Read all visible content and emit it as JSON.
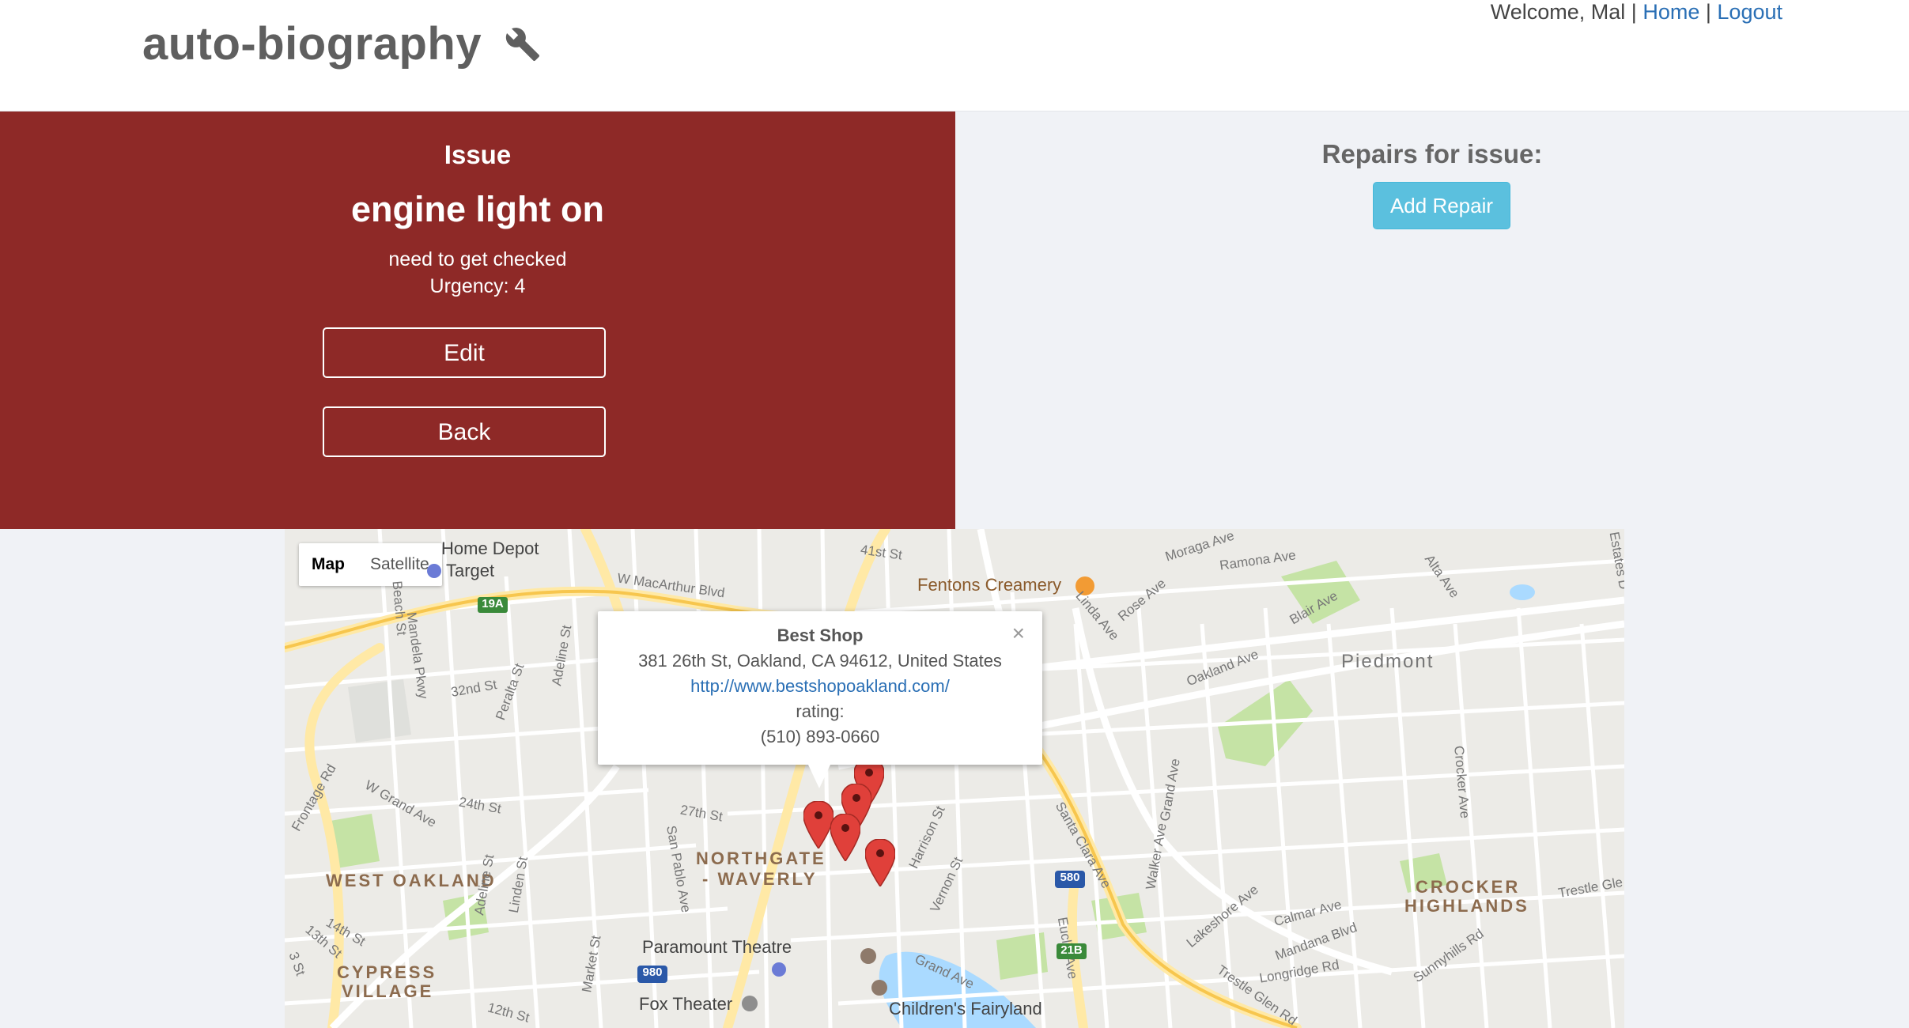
{
  "header": {
    "brand": "auto-biography",
    "welcome": "Welcome, Mal",
    "sep": "|",
    "home": "Home",
    "logout": "Logout"
  },
  "issue": {
    "heading": "Issue",
    "title": "engine light on",
    "description": "need to get checked",
    "urgency": "Urgency: 4",
    "edit_label": "Edit",
    "back_label": "Back"
  },
  "repairs": {
    "heading": "Repairs for issue:",
    "add_label": "Add Repair"
  },
  "map": {
    "type_map": "Map",
    "type_satellite": "Satellite",
    "labels": {
      "home_depot": "Home Depot",
      "target": "Target",
      "macarthur": "W MacArthur Blvd",
      "first41": "41st St",
      "fentons": "Fentons Creamery",
      "moraga": "Moraga Ave",
      "ramona": "Ramona Ave",
      "piedmont": "Piedmont",
      "oakland_ave": "Oakland Ave",
      "blair": "Blair Ave",
      "linda": "Linda Ave",
      "rose": "Rose Ave",
      "alta": "Alta Ave",
      "st32": "32nd St",
      "peralta": "Peralta St",
      "adeline": "Adeline St",
      "beach": "Beach St",
      "mandela": "Mandela Pkwy",
      "grand_ave_w": "W Grand Ave",
      "st24": "24th St",
      "st27": "27th St",
      "frontage": "Frontage Rd",
      "west_oakland": "WEST OAKLAND",
      "northgate": "NORTHGATE",
      "waverly": "- WAVERLY",
      "san_pablo": "San Pablo Ave",
      "harrison": "Harrison St",
      "vernon": "Vernon St",
      "santa_clara": "Santa Clara Ave",
      "grand_ave_e": "Grand Ave",
      "walker": "Walker Ave",
      "crocker_ave": "Crocker Ave",
      "crocker": "CROCKER",
      "highlands": "HIGHLANDS",
      "calmar": "Calmar Ave",
      "mandana": "Mandana Blvd",
      "longridge": "Longridge Rd",
      "sunnyhills": "Sunnyhills Rd",
      "lakeshore": "Lakeshore Ave",
      "trestle": "Trestle Glen Rd",
      "trestle2": "Trestle Gle",
      "paramount": "Paramount Theatre",
      "fox": "Fox Theater",
      "fairyland": "Children's Fairyland",
      "grand_ave_s": "Grand Ave",
      "euclid": "Euclid Ave",
      "market": "Market St",
      "linden": "Linden St",
      "adeline2": "Adeline St",
      "cypress": "CYPRESS",
      "village": "VILLAGE",
      "st14": "14th St",
      "st13": "13th St",
      "st12": "12th St",
      "st3": "3 St",
      "estates": "Estates D",
      "shield_19a": "19A",
      "shield_580": "580",
      "shield_980": "980",
      "shield_21b": "21B"
    },
    "infowindow": {
      "name": "Best Shop",
      "address": "381 26th St, Oakland, CA 94612, United States",
      "url": "http://www.bestshopoakland.com/",
      "rating": "rating:",
      "phone": "(510) 893-0660",
      "close": "×"
    },
    "marker_color": "#e0403a"
  }
}
